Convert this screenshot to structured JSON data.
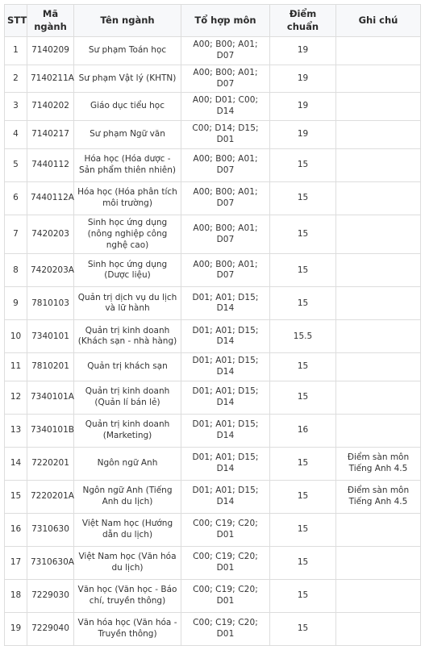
{
  "table": {
    "name": "bang-diem-chuan",
    "columns": [
      {
        "key": "stt",
        "label": "STT"
      },
      {
        "key": "ma",
        "label": "Mã ngành"
      },
      {
        "key": "ten",
        "label": "Tên ngành"
      },
      {
        "key": "to",
        "label": "Tổ hợp môn"
      },
      {
        "key": "diem",
        "label": "Điểm chuẩn"
      },
      {
        "key": "ghi",
        "label": "Ghi chú"
      }
    ],
    "rows": [
      {
        "stt": "1",
        "ma": "7140209",
        "ten": "Sư phạm Toán học",
        "to": "A00; B00; A01; D07",
        "diem": "19",
        "ghi": "",
        "lines": 1
      },
      {
        "stt": "2",
        "ma": "7140211A",
        "ten": "Sư phạm Vật lý (KHTN)",
        "to": "A00; B00; A01; D07",
        "diem": "19",
        "ghi": "",
        "lines": 1
      },
      {
        "stt": "3",
        "ma": "7140202",
        "ten": "Giáo dục tiểu học",
        "to": "A00; D01; C00; D14",
        "diem": "19",
        "ghi": "",
        "lines": 1
      },
      {
        "stt": "4",
        "ma": "7140217",
        "ten": "Sư phạm Ngữ văn",
        "to": "C00; D14; D15; D01",
        "diem": "19",
        "ghi": "",
        "lines": 1
      },
      {
        "stt": "5",
        "ma": "7440112",
        "ten": "Hóa học (Hóa dược - Sản phẩm thiên nhiên)",
        "to": "A00; B00; A01; D07",
        "diem": "15",
        "ghi": "",
        "lines": 2
      },
      {
        "stt": "6",
        "ma": "7440112A",
        "ten": "Hóa học (Hóa phân tích môi trường)",
        "to": "A00; B00; A01; D07",
        "diem": "15",
        "ghi": "",
        "lines": 2
      },
      {
        "stt": "7",
        "ma": "7420203",
        "ten": "Sinh học ứng dụng (nông nghiệp công nghệ cao)",
        "to": "A00; B00; A01; D07",
        "diem": "15",
        "ghi": "",
        "lines": 2
      },
      {
        "stt": "8",
        "ma": "7420203A",
        "ten": "Sinh học ứng dụng (Dược liệu)",
        "to": "A00; B00; A01; D07",
        "diem": "15",
        "ghi": "",
        "lines": 2
      },
      {
        "stt": "9",
        "ma": "7810103",
        "ten": "Quản trị dịch vụ du lịch và lữ hành",
        "to": "D01; A01; D15; D14",
        "diem": "15",
        "ghi": "",
        "lines": 2
      },
      {
        "stt": "10",
        "ma": "7340101",
        "ten": "Quản trị kinh doanh (Khách sạn - nhà hàng)",
        "to": "D01; A01; D15; D14",
        "diem": "15.5",
        "ghi": "",
        "lines": 2
      },
      {
        "stt": "11",
        "ma": "7810201",
        "ten": "Quản trị khách sạn",
        "to": "D01; A01; D15; D14",
        "diem": "15",
        "ghi": "",
        "lines": 1
      },
      {
        "stt": "12",
        "ma": "7340101A",
        "ten": "Quản trị kinh doanh (Quản lí bán lẻ)",
        "to": "D01; A01; D15; D14",
        "diem": "15",
        "ghi": "",
        "lines": 2
      },
      {
        "stt": "13",
        "ma": "7340101B",
        "ten": "Quản trị kinh doanh (Marketing)",
        "to": "D01; A01; D15; D14",
        "diem": "16",
        "ghi": "",
        "lines": 2
      },
      {
        "stt": "14",
        "ma": "7220201",
        "ten": "Ngôn ngữ Anh",
        "to": "D01; A01; D15; D14",
        "diem": "15",
        "ghi": "Điểm sàn môn Tiếng Anh 4.5",
        "lines": 2
      },
      {
        "stt": "15",
        "ma": "7220201A",
        "ten": "Ngôn ngữ Anh (Tiếng Anh du lịch)",
        "to": "D01; A01; D15; D14",
        "diem": "15",
        "ghi": "Điểm sàn môn Tiếng Anh 4.5",
        "lines": 2
      },
      {
        "stt": "16",
        "ma": "7310630",
        "ten": "Việt Nam học (Hướng dẫn du lịch)",
        "to": "C00; C19; C20; D01",
        "diem": "15",
        "ghi": "",
        "lines": 2
      },
      {
        "stt": "17",
        "ma": "7310630A",
        "ten": "Việt Nam học (Văn hóa du lịch)",
        "to": "C00; C19; C20; D01",
        "diem": "15",
        "ghi": "",
        "lines": 2
      },
      {
        "stt": "18",
        "ma": "7229030",
        "ten": "Văn học (Văn học - Báo chí, truyền thông)",
        "to": "C00; C19; C20; D01",
        "diem": "15",
        "ghi": "",
        "lines": 2
      },
      {
        "stt": "19",
        "ma": "7229040",
        "ten": "Văn hóa học (Văn hóa - Truyền thông)",
        "to": "C00; C19; C20; D01",
        "diem": "15",
        "ghi": "",
        "lines": 2
      }
    ]
  },
  "colors": {
    "border": "#dddddd",
    "header_bg": "#f7f8fa",
    "header_text": "#2b2b2b",
    "body_text": "#333333",
    "page_bg": "#ffffff"
  }
}
